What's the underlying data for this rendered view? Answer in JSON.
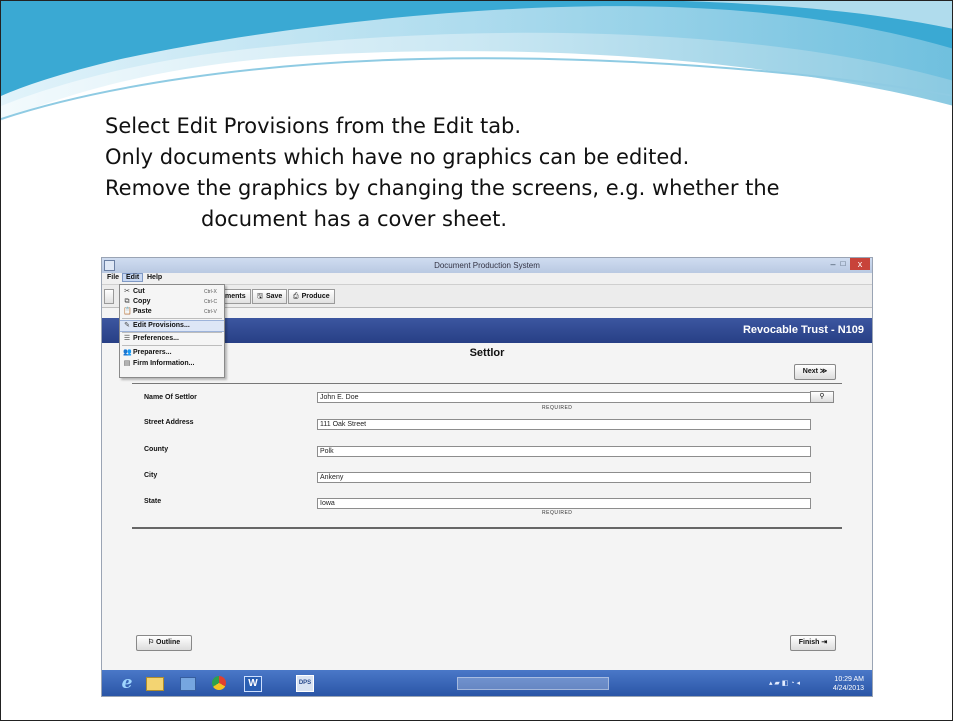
{
  "slide": {
    "lines": [
      "Select Edit Provisions from the Edit tab.",
      "Only documents which have no graphics can be edited.",
      "Remove the graphics by changing the screens, e.g. whether the",
      "document has a cover sheet."
    ]
  },
  "window": {
    "title": "Document Production System",
    "min_label": "–",
    "max_label": "□",
    "close_label": "x"
  },
  "menubar": {
    "file": "File",
    "edit": "Edit",
    "help": "Help"
  },
  "toolbar": {
    "documents_partial": "ments",
    "save": "Save",
    "produce": "Produce",
    "save_icon": "🖫",
    "produce_icon": "⎙"
  },
  "edit_menu": {
    "items": [
      {
        "label": "Cut",
        "shortcut": "Ctrl-X",
        "icon": "✂"
      },
      {
        "label": "Copy",
        "shortcut": "Ctrl-C",
        "icon": "⧉"
      },
      {
        "label": "Paste",
        "shortcut": "Ctrl-V",
        "icon": "📋"
      },
      {
        "label": "Edit Provisions...",
        "icon": "✎"
      },
      {
        "label": "Preferences...",
        "icon": "☰"
      },
      {
        "label": "Preparers...",
        "icon": "👥"
      },
      {
        "label": "Firm Information...",
        "icon": "▤"
      }
    ]
  },
  "banner": {
    "title": "Revocable Trust - N109"
  },
  "section": {
    "title": "Settlor"
  },
  "buttons": {
    "next": "Next",
    "next_icon": "≫",
    "outline": "Outline",
    "outline_icon": "⚐",
    "finish": "Finish",
    "finish_icon": "⇥",
    "lookup_icon": "⚲"
  },
  "fields": [
    {
      "label": "Name Of Settlor",
      "value": "John E. Doe",
      "note": "REQUIRED"
    },
    {
      "label": "Street Address",
      "value": "111 Oak Street"
    },
    {
      "label": "County",
      "value": "Polk"
    },
    {
      "label": "City",
      "value": "Ankeny"
    },
    {
      "label": "State",
      "value": "Iowa",
      "note": "REQUIRED"
    }
  ],
  "taskbar": {
    "ie_label": "e",
    "word_label": "W",
    "dps_label": "DPS",
    "time": "10:29 AM",
    "date": "4/24/2013"
  },
  "colors": {
    "banner": "#2f4a92",
    "taskbar": "#3a66b8",
    "close": "#c8433a",
    "swoosh": "#2fa4cf"
  }
}
